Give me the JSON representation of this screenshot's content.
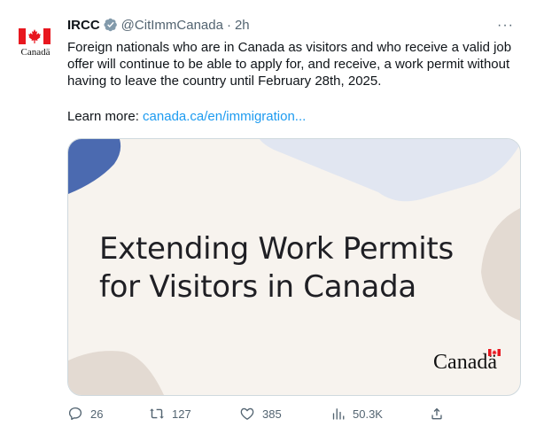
{
  "author": {
    "logo_wordmark": "Canadä",
    "name": "IRCC",
    "handle": "@CitImmCanada",
    "separator": "·",
    "time": "2h"
  },
  "more_label": "···",
  "tweet": {
    "text": "Foreign nationals who are in Canada as visitors and who receive a valid job offer will continue to be able to apply for, and receive, a work permit without having to leave the country until February 28th, 2025.",
    "learn_more_prefix": "Learn more: ",
    "link_text": "canada.ca/en/immigration..."
  },
  "media": {
    "headline_line1": "Extending Work Permits",
    "headline_line2": "for Visitors in Canada",
    "brand": "Canadä"
  },
  "actions": {
    "replies": "26",
    "reposts": "127",
    "likes": "385",
    "views": "50.3K"
  },
  "colors": {
    "canada_red": "#e8171f",
    "link_blue": "#1d9bf0",
    "verified_badge": "#829aab",
    "card_bg": "#f7f3ee",
    "shape_blue": "#4b6ab0",
    "shape_lightblue": "#e1e6f1",
    "shape_tan": "#e3dad2"
  }
}
